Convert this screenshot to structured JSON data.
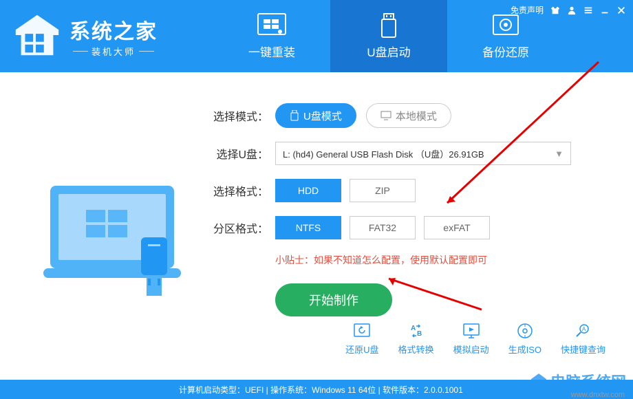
{
  "topbar": {
    "disclaimer": "免责声明"
  },
  "logo": {
    "title": "系统之家",
    "subtitle": "装机大师"
  },
  "tabs": [
    {
      "label": "一键重装",
      "active": false
    },
    {
      "label": "U盘启动",
      "active": true
    },
    {
      "label": "备份还原",
      "active": false
    }
  ],
  "form": {
    "mode_label": "选择模式：",
    "mode_usb": "U盘模式",
    "mode_local": "本地模式",
    "usb_label": "选择U盘：",
    "usb_value": "L: (hd4) General USB Flash Disk （U盘）26.91GB",
    "format_label": "选择格式：",
    "format_hdd": "HDD",
    "format_zip": "ZIP",
    "partition_label": "分区格式：",
    "partition_ntfs": "NTFS",
    "partition_fat32": "FAT32",
    "partition_exfat": "exFAT",
    "tip": "小贴士：如果不知道怎么配置，使用默认配置即可",
    "start": "开始制作"
  },
  "tools": [
    {
      "label": "还原U盘"
    },
    {
      "label": "格式转换"
    },
    {
      "label": "模拟启动"
    },
    {
      "label": "生成ISO"
    },
    {
      "label": "快捷键查询"
    }
  ],
  "statusbar": "计算机启动类型：UEFI | 操作系统：Windows 11 64位 | 软件版本：2.0.0.1001",
  "watermark": {
    "text": "电脑系统网",
    "url": "www.dnxtw.com"
  }
}
